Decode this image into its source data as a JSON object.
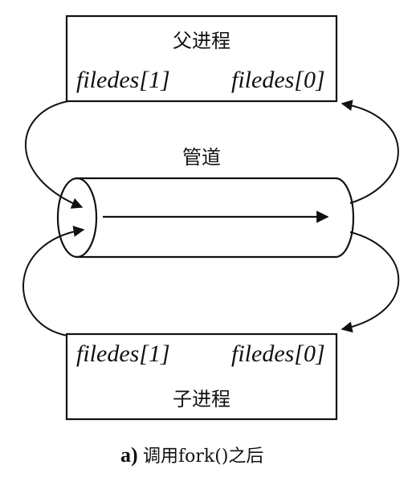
{
  "parent_process": {
    "title": "父进程",
    "fd_write": "filedes[1]",
    "fd_read": "filedes[0]"
  },
  "pipe": {
    "label": "管道"
  },
  "child_process": {
    "title": "子进程",
    "fd_write": "filedes[1]",
    "fd_read": "filedes[0]"
  },
  "caption": {
    "prefix": "a)",
    "text": "调用fork()之后"
  }
}
